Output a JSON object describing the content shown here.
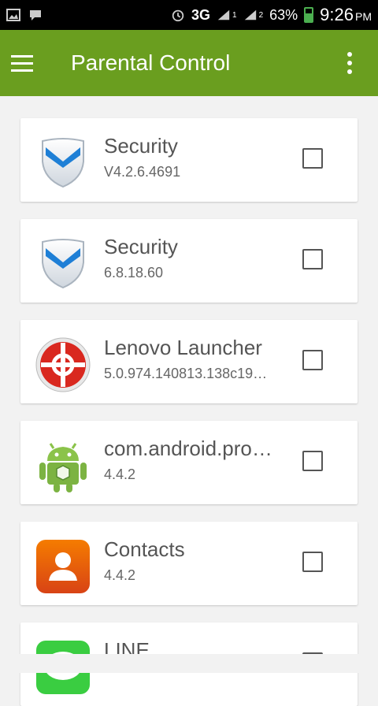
{
  "colors": {
    "accent": "#6a9e1f",
    "statusbar": "#000000",
    "background": "#f2f2f2"
  },
  "statusbar": {
    "left_icons": [
      "gallery-icon",
      "bbm-icon"
    ],
    "network": "3G",
    "signal_1": "1",
    "signal_2": "2",
    "battery": "63%",
    "battery_level": 63,
    "time": "9:26",
    "ampm": "PM"
  },
  "appbar": {
    "title": "Parental Control",
    "menu_icon": "hamburger-menu-icon",
    "overflow_icon": "overflow-menu-icon"
  },
  "apps": [
    {
      "name": "Security",
      "version": "V4.2.6.4691",
      "checked": false,
      "icon": "shield-icon"
    },
    {
      "name": "Security",
      "version": "6.8.18.60",
      "checked": false,
      "icon": "shield-icon"
    },
    {
      "name": "Lenovo Launcher",
      "version": "5.0.974.140813.138c19…",
      "checked": false,
      "icon": "lenovo-launcher-icon"
    },
    {
      "name": "com.android.pro…",
      "version": "4.4.2",
      "checked": false,
      "icon": "android-robot-icon"
    },
    {
      "name": "Contacts",
      "version": "4.4.2",
      "checked": false,
      "icon": "contacts-icon"
    },
    {
      "name": "LINE",
      "version": "",
      "checked": false,
      "icon": "line-icon"
    }
  ]
}
